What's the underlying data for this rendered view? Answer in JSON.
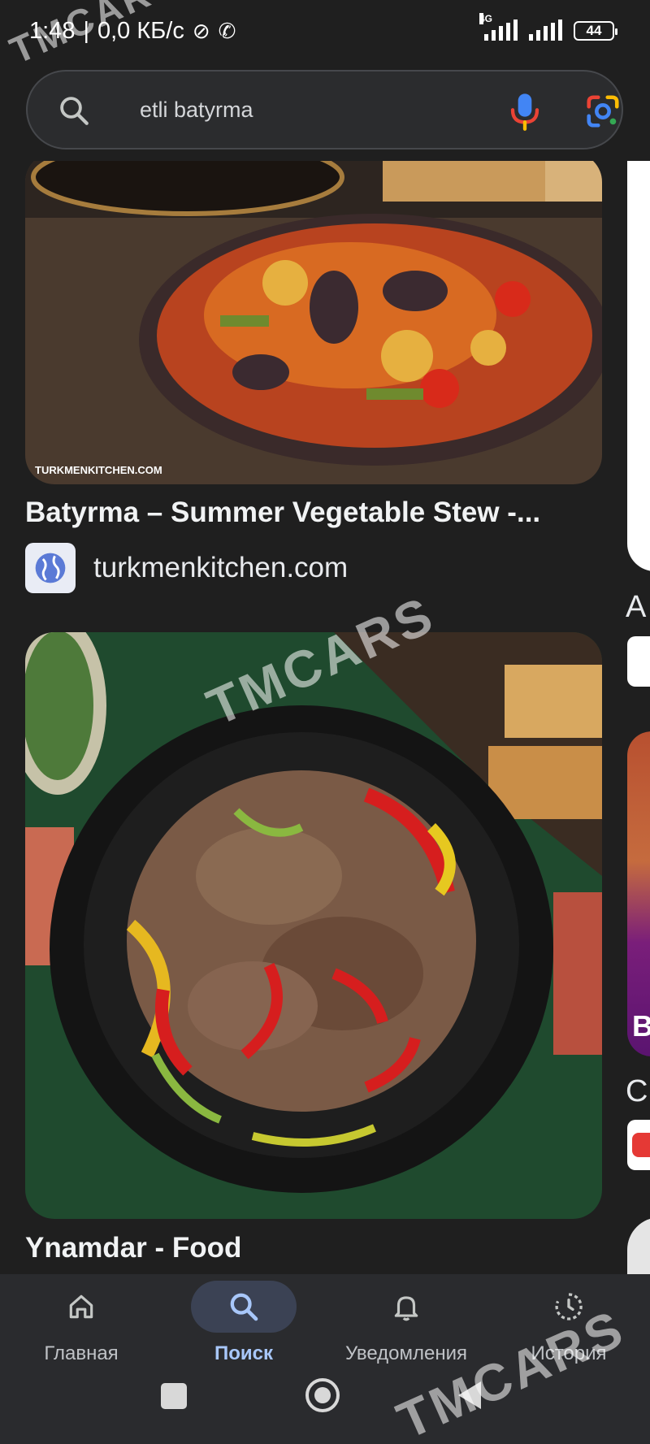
{
  "status_bar": {
    "time": "1:48",
    "speed": "0,0 КБ/с",
    "network": "4G",
    "battery": "44"
  },
  "search": {
    "query": "etli batyrma"
  },
  "results": [
    {
      "title": "Batyrma – Summer Vegetable Stew -...",
      "source": "turkmenkitchen.com",
      "image_watermark": "TURKMENKITCHEN.COM"
    },
    {
      "title": "Ynamdar - Food"
    }
  ],
  "side_peek": {
    "letter_a": "A",
    "letter_b": "B",
    "letter_c": "C"
  },
  "bottom_nav": {
    "items": [
      {
        "label": "Главная",
        "icon": "home-icon"
      },
      {
        "label": "Поиск",
        "icon": "search-icon"
      },
      {
        "label": "Уведомления",
        "icon": "bell-icon"
      },
      {
        "label": "История",
        "icon": "history-icon"
      }
    ],
    "active_index": 1
  },
  "watermark": {
    "text": "TMCARS"
  },
  "colors": {
    "background": "#1f1f1f",
    "accent": "#a8c7fa",
    "active_pill": "#3b4254"
  }
}
